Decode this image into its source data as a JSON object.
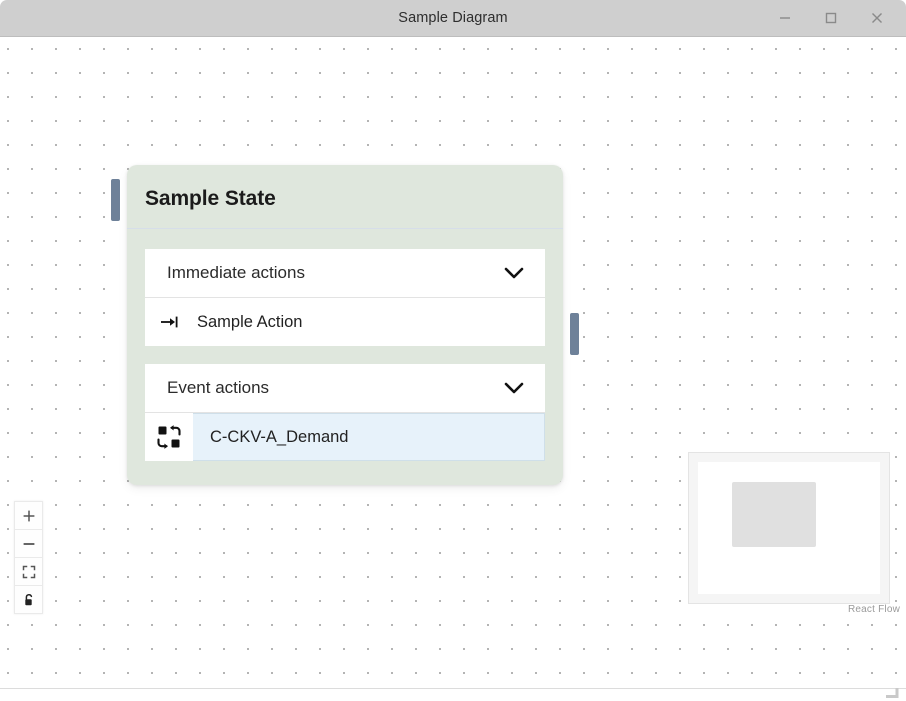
{
  "window": {
    "title": "Sample Diagram",
    "controls": [
      {
        "name": "minimize-button",
        "icon": "minimize-icon",
        "label": "–"
      },
      {
        "name": "maximize-button",
        "icon": "maximize-icon",
        "label": "□"
      },
      {
        "name": "close-button",
        "icon": "close-icon",
        "label": "✕"
      }
    ]
  },
  "node": {
    "title": "Sample State",
    "accent_color": "#dfe7dd",
    "handle_color": "#6e8199",
    "sections": [
      {
        "label": "Immediate actions",
        "collapse_icon": "chevron-down-icon",
        "rows": [
          {
            "label": "Sample Action",
            "icon": "arrow-to-bar-icon",
            "highlighted": false
          }
        ]
      },
      {
        "label": "Event actions",
        "collapse_icon": "chevron-down-icon",
        "rows": [
          {
            "label": "C-CKV-A_Demand",
            "icon": "transition-swap-icon",
            "highlighted": true,
            "highlight_color": "#e7f2fa"
          }
        ]
      }
    ]
  },
  "controls": {
    "buttons": [
      {
        "name": "zoom-in-button",
        "icon": "plus-icon"
      },
      {
        "name": "zoom-out-button",
        "icon": "minus-icon"
      },
      {
        "name": "fit-view-button",
        "icon": "fit-view-icon"
      },
      {
        "name": "lock-button",
        "icon": "unlock-icon"
      }
    ]
  },
  "minimap": {
    "node_color": "#e0e0e0",
    "attribution": "React Flow"
  }
}
